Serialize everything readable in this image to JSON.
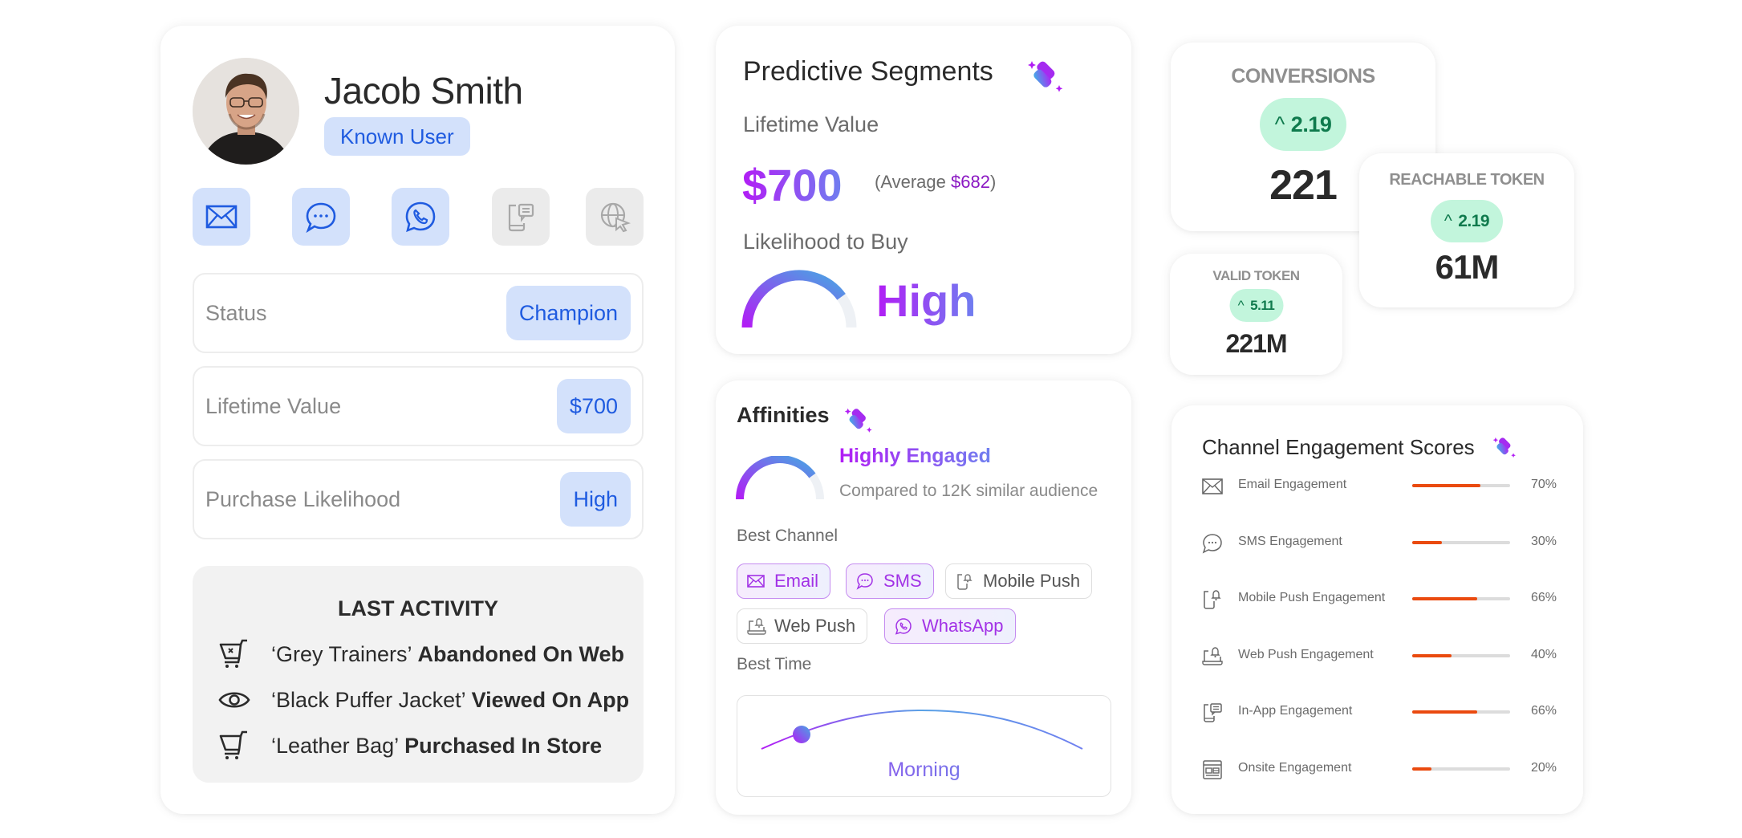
{
  "profile": {
    "name": "Jacob Smith",
    "badge": "Known User",
    "channels": [
      {
        "icon": "email-icon",
        "active": true
      },
      {
        "icon": "sms-chat-icon",
        "active": true
      },
      {
        "icon": "whatsapp-icon",
        "active": true
      },
      {
        "icon": "in-app-message-icon",
        "active": false
      },
      {
        "icon": "web-cursor-icon",
        "active": false
      }
    ],
    "fields": [
      {
        "label": "Status",
        "value": "Champion"
      },
      {
        "label": "Lifetime Value",
        "value": "$700"
      },
      {
        "label": "Purchase Likelihood",
        "value": "High"
      }
    ],
    "last_activity": {
      "title": "LAST ACTIVITY",
      "items": [
        {
          "icon": "abandoned-cart-icon",
          "item": "‘Grey Trainers’",
          "action": "Abandoned On Web"
        },
        {
          "icon": "eye-icon",
          "item": "‘Black Puffer Jacket’",
          "action": "Viewed On App"
        },
        {
          "icon": "cart-icon",
          "item": "‘Leather Bag’",
          "action": "Purchased In Store"
        }
      ]
    }
  },
  "predictive": {
    "title": "Predictive Segments",
    "ltv_label": "Lifetime Value",
    "ltv_value": "$700",
    "avg_prefix": "(Average ",
    "avg_value": "$682",
    "avg_suffix": ")",
    "likelihood_label": "Likelihood to Buy",
    "likelihood_value": "High",
    "likelihood_gauge_fraction": 0.8
  },
  "affinities": {
    "title": "Affinities",
    "engagement_level": "Highly Engaged",
    "engagement_gauge_fraction": 0.8,
    "compared_text": "Compared to 12K similar audience",
    "best_channel_label": "Best Channel",
    "channels": [
      {
        "label": "Email",
        "icon": "email-icon",
        "active": true
      },
      {
        "label": "SMS",
        "icon": "sms-chat-icon",
        "active": true
      },
      {
        "label": "Mobile Push",
        "icon": "mobile-push-icon",
        "active": false
      },
      {
        "label": "Web Push",
        "icon": "web-push-icon",
        "active": false
      },
      {
        "label": "WhatsApp",
        "icon": "whatsapp-icon",
        "active": true
      }
    ],
    "best_time_label": "Best Time",
    "best_time_value": "Morning"
  },
  "kpis": {
    "conversions": {
      "label": "CONVERSIONS",
      "change": "2.19",
      "value": "221"
    },
    "reachable_token": {
      "label": "REACHABLE TOKEN",
      "change": "2.19",
      "value": "61M"
    },
    "valid_token": {
      "label": "VALID TOKEN",
      "change": "5.11",
      "value": "221M"
    }
  },
  "engagement": {
    "title": "Channel Engagement Scores",
    "rows": [
      {
        "label": "Email Engagement",
        "icon": "email-icon",
        "percent": 70,
        "display": "70%"
      },
      {
        "label": "SMS Engagement",
        "icon": "sms-chat-icon",
        "percent": 30,
        "display": "30%"
      },
      {
        "label": "Mobile Push Engagement",
        "icon": "mobile-push-icon",
        "percent": 66,
        "display": "66%"
      },
      {
        "label": "Web Push Engagement",
        "icon": "web-push-icon",
        "percent": 40,
        "display": "40%"
      },
      {
        "label": "In-App Engagement",
        "icon": "in-app-message-icon",
        "percent": 66,
        "display": "66%"
      },
      {
        "label": "Onsite Engagement",
        "icon": "onsite-layout-icon",
        "percent": 20,
        "display": "20%"
      }
    ]
  },
  "colors": {
    "primary_blue": "#1f5be0",
    "blue_badge_bg": "#d3e1fb",
    "ai_gradient_start": "#b21df5",
    "ai_gradient_end": "#6f7ff0",
    "positive_green": "#0f7a4d",
    "positive_green_bg": "#c2f5dc",
    "engagement_bar": "#ea4a0f"
  }
}
